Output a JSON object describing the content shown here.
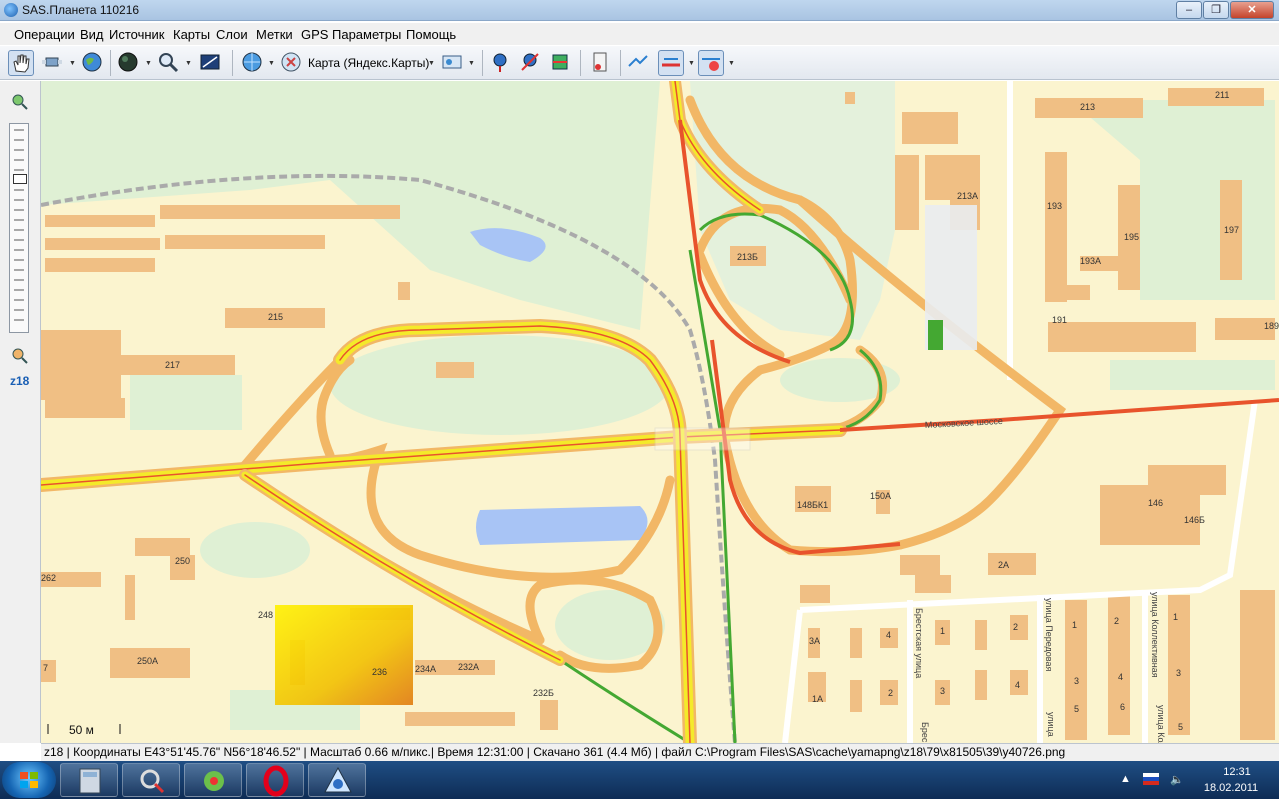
{
  "window": {
    "title": "SAS.Планета 110216"
  },
  "menu": [
    "Операции",
    "Вид",
    "Источник",
    "Карты",
    "Слои",
    "Метки",
    "GPS",
    "Параметры",
    "Помощь"
  ],
  "toolbar": {
    "map_source": "Карта (Яндекс.Карты)"
  },
  "zoom": {
    "level": "z18"
  },
  "map": {
    "road_name": "Московское шоссе",
    "scale": "50 м",
    "houses": [
      "213",
      "211",
      "213А",
      "193",
      "195",
      "197",
      "193А",
      "191",
      "189",
      "213Б",
      "215",
      "217",
      "150А",
      "148БК1",
      "146",
      "146Б",
      "2А",
      "250",
      "262",
      "248",
      "250А",
      "7",
      "234А",
      "232А",
      "236",
      "232Б",
      "3А",
      "4",
      "1А",
      "2",
      "1",
      "2",
      "3",
      "4",
      "1",
      "2",
      "3",
      "4",
      "5",
      "6",
      "1",
      "3",
      "5"
    ],
    "streets": [
      "Брестская улица",
      "улица Передовая",
      "улица Коллективная",
      "Брес",
      "улица",
      "улица Кол"
    ]
  },
  "status": "z18 | Координаты E43°51'45.76\" N56°18'46.52\" | Масштаб 0.66 м/пикс.| Время 12:31:00 | Скачано 361 (4.4 Мб) | файл C:\\Program Files\\SAS\\cache\\yamapng\\z18\\79\\x81505\\39\\y40726.png",
  "taskbar": {
    "time": "12:31",
    "date": "18.02.2011"
  },
  "colors": {
    "road": "#f2b766",
    "highway": "#f4ea2a",
    "jam": "#e8532c",
    "free": "#44a832",
    "park": "#dff0d4",
    "water": "#a8c4f5",
    "building": "#f0bf84"
  }
}
